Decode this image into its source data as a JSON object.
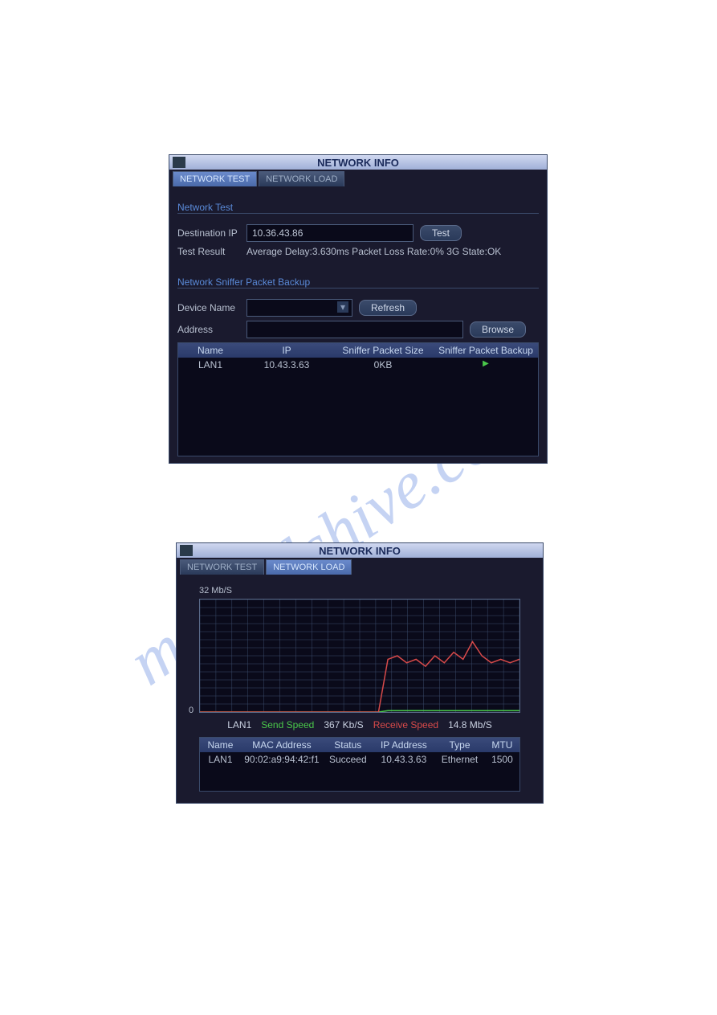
{
  "watermark": "manualshive.com",
  "window1": {
    "title": "NETWORK INFO",
    "tabs": {
      "test": "NETWORK TEST",
      "load": "NETWORK LOAD"
    },
    "section_test": "Network Test",
    "dest_label": "Destination IP",
    "dest_value": "10.36.43.86",
    "test_btn": "Test",
    "result_label": "Test Result",
    "result_value": "Average Delay:3.630ms  Packet Loss Rate:0%  3G State:OK",
    "section_sniffer": "Network Sniffer Packet Backup",
    "device_label": "Device Name",
    "refresh_btn": "Refresh",
    "address_label": "Address",
    "browse_btn": "Browse",
    "table": {
      "headers": [
        "Name",
        "IP",
        "Sniffer Packet Size",
        "Sniffer Packet Backup"
      ],
      "row": [
        "LAN1",
        "10.43.3.63",
        "0KB",
        ""
      ]
    }
  },
  "window2": {
    "title": "NETWORK INFO",
    "tabs": {
      "test": "NETWORK TEST",
      "load": "NETWORK LOAD"
    },
    "y_top": "32 Mb/S",
    "y_zero": "0",
    "legend": {
      "lan": "LAN1",
      "send_label": "Send Speed",
      "send_val": "367 Kb/S",
      "recv_label": "Receive Speed",
      "recv_val": "14.8 Mb/S"
    },
    "table": {
      "headers": [
        "Name",
        "MAC Address",
        "Status",
        "IP Address",
        "Type",
        "MTU"
      ],
      "row": [
        "LAN1",
        "90:02:a9:94:42:f1",
        "Succeed",
        "10.43.3.63",
        "Ethernet",
        "1500"
      ]
    }
  },
  "chart_data": {
    "type": "line",
    "title": "",
    "xlabel": "",
    "ylabel": "Mb/S",
    "ylim": [
      0,
      32
    ],
    "x": [
      0,
      1,
      2,
      3,
      4,
      5,
      6,
      7,
      8,
      9,
      10,
      11,
      12,
      13,
      14,
      15,
      16,
      17,
      18,
      19,
      20,
      21,
      22,
      23,
      24,
      25,
      26,
      27,
      28,
      29,
      30,
      31,
      32,
      33,
      34
    ],
    "series": [
      {
        "name": "Send Speed",
        "color": "#4ac84a",
        "values": [
          0,
          0,
          0,
          0,
          0,
          0,
          0,
          0,
          0,
          0,
          0,
          0,
          0,
          0,
          0,
          0,
          0,
          0,
          0,
          0,
          0.4,
          0.4,
          0.4,
          0.4,
          0.4,
          0.4,
          0.4,
          0.4,
          0.4,
          0.4,
          0.4,
          0.4,
          0.4,
          0.4,
          0.4
        ]
      },
      {
        "name": "Receive Speed",
        "color": "#d84a4a",
        "values": [
          0,
          0,
          0,
          0,
          0,
          0,
          0,
          0,
          0,
          0,
          0,
          0,
          0,
          0,
          0,
          0,
          0,
          0,
          0,
          0,
          15,
          16,
          14,
          15,
          13,
          16,
          14,
          17,
          15,
          20,
          16,
          14,
          15,
          14,
          15
        ]
      }
    ]
  }
}
